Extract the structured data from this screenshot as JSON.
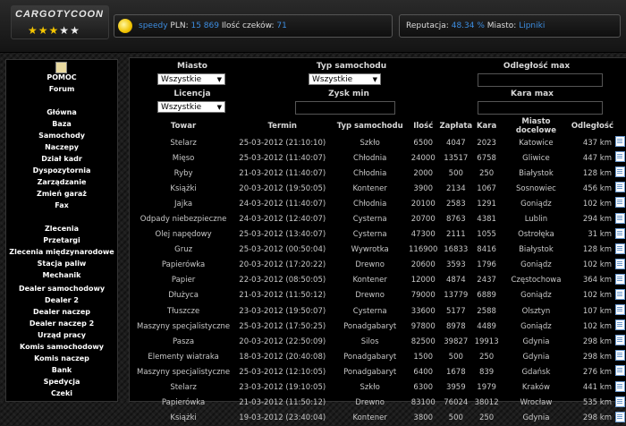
{
  "header": {
    "logo_text": "CARGOTYCOON",
    "stars_filled": 3,
    "stars_total": 5,
    "user": "speedy",
    "pln_label": "PLN:",
    "pln_value": "15 869",
    "cheques_label": "Ilość czeków:",
    "cheques_value": "71",
    "reputation_label": "Reputacja:",
    "reputation_value": "48.34 %",
    "city_label": "Miasto:",
    "city_value": "Lipniki"
  },
  "sidebar": {
    "items": [
      "POMOC",
      "Forum",
      "Główna",
      "Baza",
      "Samochody",
      "Naczepy",
      "Dział kadr",
      "Dyspozytornia",
      "Zarządzanie",
      "Zmień garaż",
      "Fax",
      "Zlecenia",
      "Przetargi",
      "Zlecenia międzynarodowe",
      "Stacja paliw",
      "Mechanik",
      "Dealer samochodowy",
      "Dealer 2",
      "Dealer naczep",
      "Dealer naczep 2",
      "Urząd pracy",
      "Komis samochodowy",
      "Komis naczep",
      "Bank",
      "Spedycja",
      "Czeki"
    ]
  },
  "filters": {
    "city_label": "Miasto",
    "city_value": "Wszystkie",
    "vehicle_label": "Typ samochodu",
    "vehicle_value": "Wszystkie",
    "distance_label": "Odległość max",
    "license_label": "Licencja",
    "license_value": "Wszystkie",
    "profit_label": "Zysk min",
    "cargo_label": "Kara max"
  },
  "table": {
    "headers": [
      "Towar",
      "Termin",
      "Typ samochodu",
      "Ilość",
      "Zapłata",
      "Kara",
      "Miasto docelowe",
      "Odległość",
      ""
    ],
    "rows": [
      [
        "Stelarz",
        "25-03-2012 (21:10:10)",
        "Szkło",
        "6500",
        "4047",
        "2023",
        "Katowice",
        "437 km"
      ],
      [
        "Mięso",
        "25-03-2012 (11:40:07)",
        "Chłodnia",
        "24000",
        "13517",
        "6758",
        "Gliwice",
        "447 km"
      ],
      [
        "Ryby",
        "21-03-2012 (11:40:07)",
        "Chłodnia",
        "2000",
        "500",
        "250",
        "Białystok",
        "128 km"
      ],
      [
        "Książki",
        "20-03-2012 (19:50:05)",
        "Kontener",
        "3900",
        "2134",
        "1067",
        "Sosnowiec",
        "456 km"
      ],
      [
        "Jajka",
        "24-03-2012 (11:40:07)",
        "Chłodnia",
        "20100",
        "2583",
        "1291",
        "Goniądz",
        "102 km"
      ],
      [
        "Odpady niebezpieczne",
        "24-03-2012 (12:40:07)",
        "Cysterna",
        "20700",
        "8763",
        "4381",
        "Lublin",
        "294 km"
      ],
      [
        "Olej napędowy",
        "25-03-2012 (13:40:07)",
        "Cysterna",
        "47300",
        "2111",
        "1055",
        "Ostrołęka",
        "31 km"
      ],
      [
        "Gruz",
        "25-03-2012 (00:50:04)",
        "Wywrotka",
        "116900",
        "16833",
        "8416",
        "Białystok",
        "128 km"
      ],
      [
        "Papierówka",
        "20-03-2012 (17:20:22)",
        "Drewno",
        "20600",
        "3593",
        "1796",
        "Goniądz",
        "102 km"
      ],
      [
        "Papier",
        "22-03-2012 (08:50:05)",
        "Kontener",
        "12000",
        "4874",
        "2437",
        "Częstochowa",
        "364 km"
      ],
      [
        "Dłużyca",
        "21-03-2012 (11:50:12)",
        "Drewno",
        "79000",
        "13779",
        "6889",
        "Goniądz",
        "102 km"
      ],
      [
        "Tłuszcze",
        "23-03-2012 (19:50:07)",
        "Cysterna",
        "33600",
        "5177",
        "2588",
        "Olsztyn",
        "107 km"
      ],
      [
        "Maszyny specjalistyczne",
        "25-03-2012 (17:50:25)",
        "Ponadgabaryt",
        "97800",
        "8978",
        "4489",
        "Goniądz",
        "102 km"
      ],
      [
        "Pasza",
        "20-03-2012 (22:50:09)",
        "Silos",
        "82500",
        "39827",
        "19913",
        "Gdynia",
        "298 km"
      ],
      [
        "Elementy wiatraka",
        "18-03-2012 (20:40:08)",
        "Ponadgabaryt",
        "1500",
        "500",
        "250",
        "Gdynia",
        "298 km"
      ],
      [
        "Maszyny specjalistyczne",
        "25-03-2012 (12:10:05)",
        "Ponadgabaryt",
        "6400",
        "1678",
        "839",
        "Gdańsk",
        "276 km"
      ],
      [
        "Stelarz",
        "23-03-2012 (19:10:05)",
        "Szkło",
        "6300",
        "3959",
        "1979",
        "Kraków",
        "441 km"
      ],
      [
        "Papierówka",
        "21-03-2012 (11:50:12)",
        "Drewno",
        "83100",
        "76024",
        "38012",
        "Wrocław",
        "535 km"
      ],
      [
        "Książki",
        "19-03-2012 (23:40:04)",
        "Kontener",
        "3800",
        "500",
        "250",
        "Gdynia",
        "298 km"
      ]
    ]
  }
}
